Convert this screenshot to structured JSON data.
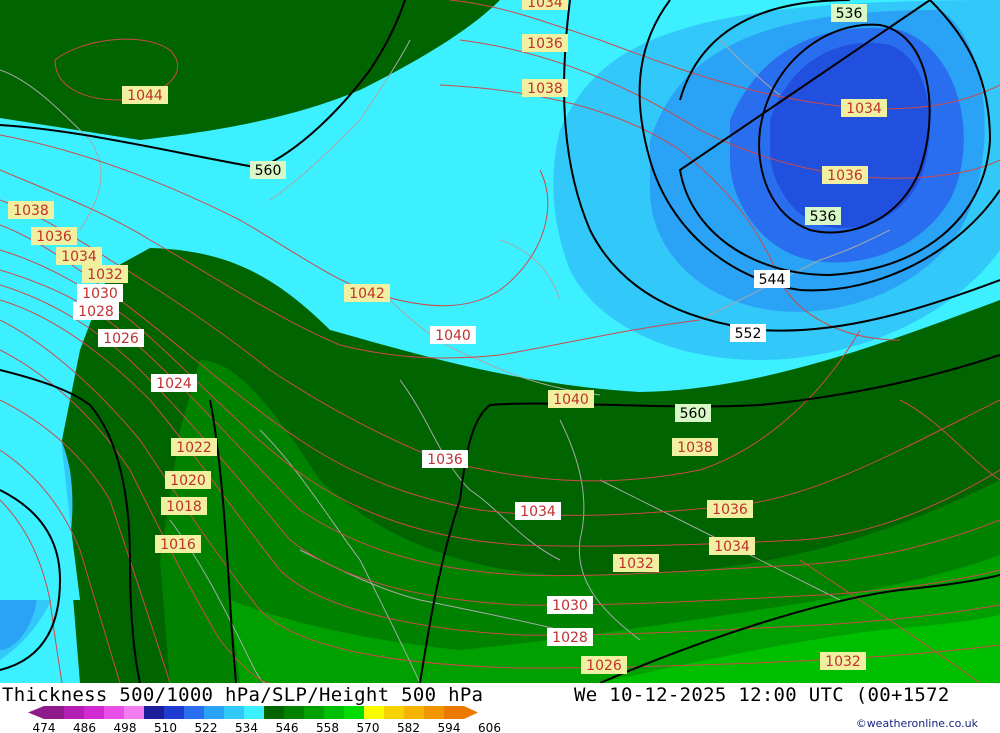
{
  "header": {
    "title": "Thickness 500/1000 hPa/SLP/Height 500 hPa",
    "datetime": "We 10-12-2025 12:00 UTC (00+1572"
  },
  "credit": "©weatheronline.co.uk",
  "legend": {
    "ticks": [
      "474",
      "486",
      "498",
      "510",
      "522",
      "534",
      "546",
      "558",
      "570",
      "582",
      "594",
      "606"
    ],
    "colors": [
      "#8e1a8c",
      "#b41eb4",
      "#d22ad2",
      "#e650e6",
      "#f07cf0",
      "#1e1e9a",
      "#1e3cd2",
      "#2a6ef0",
      "#2aa2f5",
      "#32c8fa",
      "#3cf0ff",
      "#006400",
      "#008200",
      "#00a000",
      "#00be00",
      "#00dc00",
      "#fafa00",
      "#f5d200",
      "#f5b400",
      "#f09600",
      "#eb7800"
    ]
  },
  "map": {
    "slp_labels": [
      "1044",
      "1034",
      "1036",
      "1038",
      "1034",
      "1036",
      "1038",
      "1036",
      "1034",
      "1032",
      "1030",
      "1028",
      "1026",
      "1024",
      "1022",
      "1020",
      "1018",
      "1016",
      "1042",
      "1040",
      "1040",
      "1036",
      "1038",
      "1034",
      "1036",
      "1034",
      "1032",
      "1030",
      "1028",
      "1026",
      "1032"
    ],
    "height_labels": [
      "536",
      "536",
      "544",
      "552",
      "560",
      "560"
    ]
  }
}
